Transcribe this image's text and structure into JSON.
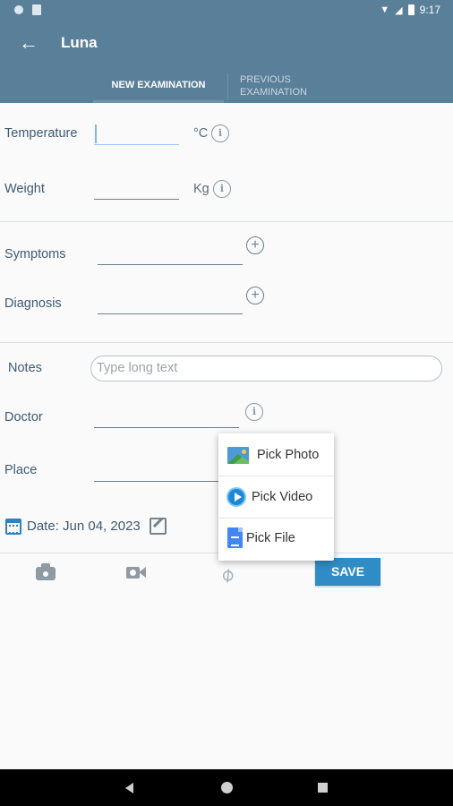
{
  "status_bar": {
    "time": "9:17"
  },
  "app_bar": {
    "title": "Luna"
  },
  "tabs": [
    {
      "label": "NEW EXAMINATION",
      "active": true
    },
    {
      "label_line1": "PREVIOUS",
      "label_line2": "EXAMINATION",
      "active": false
    }
  ],
  "form": {
    "temperature": {
      "label": "Temperature",
      "value": "",
      "unit": "°C"
    },
    "weight": {
      "label": "Weight",
      "value": "",
      "unit": "Kg"
    },
    "symptoms": {
      "label": "Symptoms",
      "value": ""
    },
    "diagnosis": {
      "label": "Diagnosis",
      "value": ""
    },
    "notes": {
      "label": "Notes",
      "placeholder": "Type long text",
      "value": ""
    },
    "doctor": {
      "label": "Doctor",
      "value": ""
    },
    "place": {
      "label": "Place",
      "value": ""
    },
    "date": {
      "text": "Date: Jun 04, 2023"
    }
  },
  "popup_menu": {
    "items": [
      {
        "label": "Pick Photo",
        "icon": "photo-icon"
      },
      {
        "label": "Pick Video",
        "icon": "play-icon"
      },
      {
        "label": "Pick File",
        "icon": "file-icon"
      }
    ]
  },
  "toolbar": {
    "save_label": "SAVE"
  },
  "colors": {
    "app_bar": "#5a7f99",
    "save_button": "#2f8cc4"
  }
}
